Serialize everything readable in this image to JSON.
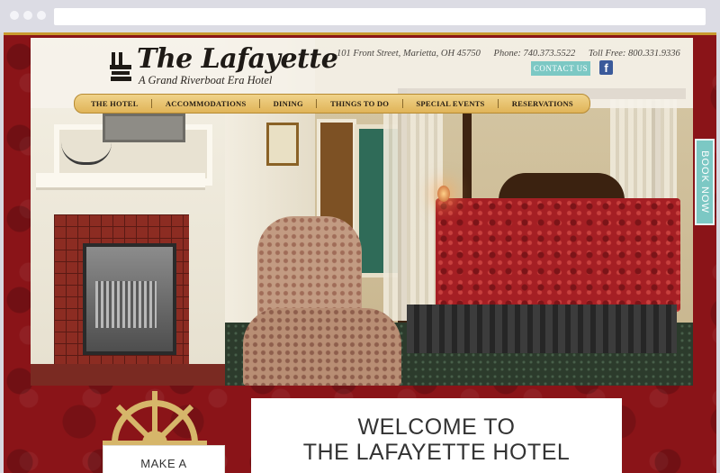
{
  "hotel": {
    "name": "The Lafayette",
    "tagline": "A Grand Riverboat Era Hotel",
    "address": "101 Front Street, Marietta, OH 45750",
    "phone": "Phone: 740.373.5522",
    "toll_free": "Toll Free: 800.331.9336"
  },
  "header": {
    "contact_label": "CONTACT US",
    "facebook_icon": "facebook-icon"
  },
  "nav": {
    "items": [
      {
        "label": "THE HOTEL"
      },
      {
        "label": "ACCOMMODATIONS"
      },
      {
        "label": "DINING"
      },
      {
        "label": "THINGS TO DO"
      },
      {
        "label": "SPECIAL EVENTS"
      },
      {
        "label": "RESERVATIONS"
      }
    ]
  },
  "side_tab": {
    "label": "BOOK NOW"
  },
  "reservation": {
    "label": "MAKE A"
  },
  "welcome": {
    "line1": "WELCOME TO",
    "line2": "THE LAFAYETTE HOTEL"
  },
  "colors": {
    "brand_red": "#8a1418",
    "accent_gold": "#c99a2e",
    "accent_teal": "#7cc8c4"
  }
}
